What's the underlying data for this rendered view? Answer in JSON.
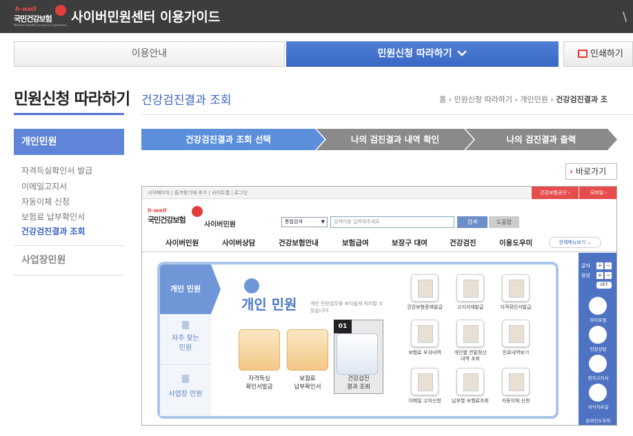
{
  "window": {
    "title": "사이버민원센터 이용가이드",
    "logo_text": "국민건강보험",
    "logo_tagline": "h-well",
    "logo_sub": "National Health Insurance Corporation",
    "close_symbol": "\\"
  },
  "tabs": {
    "info_label": "이용안내",
    "follow_label": "민원신청 따라하기",
    "print_label": "인쇄하기"
  },
  "leftnav": {
    "title": "민원신청 따라하기",
    "group1": "개인민원",
    "items": [
      "자격득실확인서 발급",
      "이메일고지서",
      "자동이체 신청",
      "보험료 납부확인서",
      "건강검진결과 조회"
    ],
    "group2": "사업장민원"
  },
  "main": {
    "title": "건강검진결과 조회",
    "breadcrumb": [
      "홈",
      "민원신청 따라하기",
      "개인민원",
      "건강검진결과 조"
    ],
    "steps": [
      "건강검진결과 조회 선택",
      "나의 검진결과 내역 확인",
      "나의 검진결과 출력"
    ],
    "back_label": "바로가기"
  },
  "inner": {
    "toolbar": "시작페이지  |  즐겨찾기에 추가  |  사이트맵  |  로그인",
    "toolbar_right1": "건강보험공단 ›",
    "toolbar_right2": "모바일 ›",
    "logo_hw": "h-well",
    "logo_nm": "국민건강보험",
    "logo_site": "사이버민원",
    "search_scope": "통합검색",
    "search_placeholder": "검색어를 입력해주세요",
    "search_btn": "검색",
    "help_btn": "도움말",
    "menu": [
      "사이버민원",
      "사이버상담",
      "건강보험안내",
      "보험급여",
      "보장구 대여",
      "건강검진",
      "이용도우미"
    ],
    "menu_all": "전체메뉴보기 ⌄",
    "panel_tabs": [
      "개인 민원",
      "자주 찾는 민원",
      "사업장 민원"
    ],
    "panel_heading": "개인 민원",
    "panel_sub": "개인 민원업무를 보다쉽게 처리할 수 있습니다.",
    "big_tiles": [
      "자격득실\n확인서발급",
      "보험료\n납부확인서",
      "건강검진\n결과 조회"
    ],
    "badge": "01",
    "small_tiles": [
      "건강보험증재발급",
      "고지서재발급",
      "자격확인서발급",
      "보험료 부과내역",
      "개인별 연말정산\n내역 조회",
      "진료내역보기",
      "이메일 고지신청",
      "납부할 보험료조회",
      "자동이체 신청"
    ],
    "rail": {
      "font_label": "글자",
      "sound_label": "음성",
      "off_label": "OFF",
      "items": [
        "마이포털",
        "민원상담",
        "전자고지서",
        "서식자료실"
      ],
      "bottom": "온라인도우미"
    }
  }
}
